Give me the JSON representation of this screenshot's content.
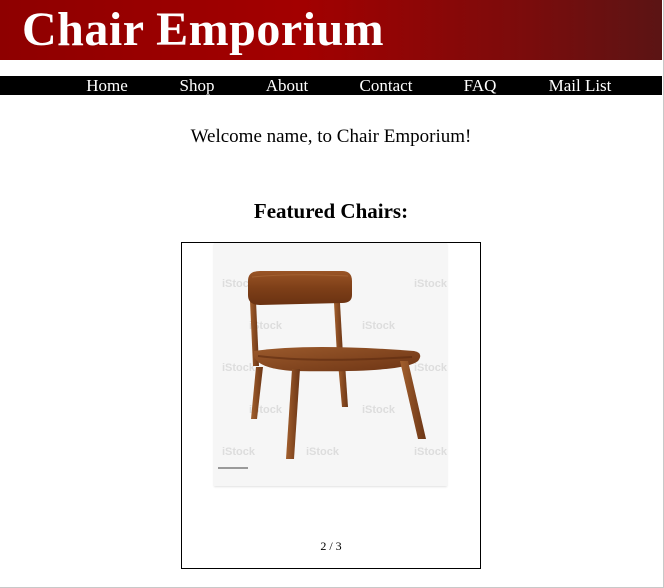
{
  "header": {
    "site_title": "Chair Emporium",
    "banner_gradient": [
      "#8e0000",
      "#a30000",
      "#7a0c0c",
      "#5b1414"
    ]
  },
  "nav": {
    "items": [
      {
        "label": "Home"
      },
      {
        "label": "Shop"
      },
      {
        "label": "About"
      },
      {
        "label": "Contact"
      },
      {
        "label": "FAQ"
      },
      {
        "label": "Mail List"
      }
    ]
  },
  "main": {
    "welcome_text": "Welcome name, to Chair Emporium!",
    "featured_heading": "Featured Chairs:"
  },
  "slideshow": {
    "counter": "2 / 3",
    "image_subject": "wooden-chair",
    "watermark": "iStock"
  },
  "colors": {
    "navbar_bg": "#000000",
    "nav_text": "#ffffff",
    "chair_wood": "#8a4a22"
  }
}
